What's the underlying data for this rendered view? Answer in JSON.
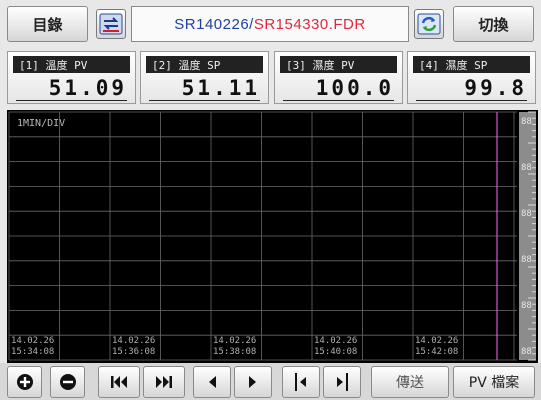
{
  "header": {
    "menu_label": "目錄",
    "file_name_prefix": "SR140226/",
    "file_name_active": "SR154330.FDR",
    "switch_label": "切換",
    "colors": {
      "prefix": "#1e3fa0",
      "active": "#e0283c"
    }
  },
  "channels": [
    {
      "label": "[1] 溫度 PV",
      "value": "51.09"
    },
    {
      "label": "[2] 溫度 SP",
      "value": "51.11"
    },
    {
      "label": "[3] 濕度 PV",
      "value": "100.0"
    },
    {
      "label": "[4] 濕度 SP",
      "value": "99.8"
    }
  ],
  "chart": {
    "div_label": "1MIN/DIV",
    "time_labels": [
      {
        "date": "14.02.26",
        "time": "15:34:08"
      },
      {
        "date": "14.02.26",
        "time": "15:36:08"
      },
      {
        "date": "14.02.26",
        "time": "15:38:08"
      },
      {
        "date": "14.02.26",
        "time": "15:40:08"
      },
      {
        "date": "14.02.26",
        "time": "15:42:08"
      }
    ],
    "right_scale_labels": [
      "88",
      "88",
      "88",
      "88",
      "88",
      "88"
    ],
    "cursor_color": "#ff66ff",
    "grid_color": "#6a6a6a"
  },
  "toolbar": {
    "zoom_in_icon": "plus-circle-icon",
    "zoom_out_icon": "minus-circle-icon",
    "first_icon": "skip-first-icon",
    "last_icon": "skip-last-icon",
    "prev_icon": "prev-icon",
    "next_icon": "next-icon",
    "cursor_left_icon": "cursor-left-icon",
    "cursor_right_icon": "cursor-right-icon",
    "send_label": "傳送",
    "pv_file_label": "PV 檔案"
  }
}
